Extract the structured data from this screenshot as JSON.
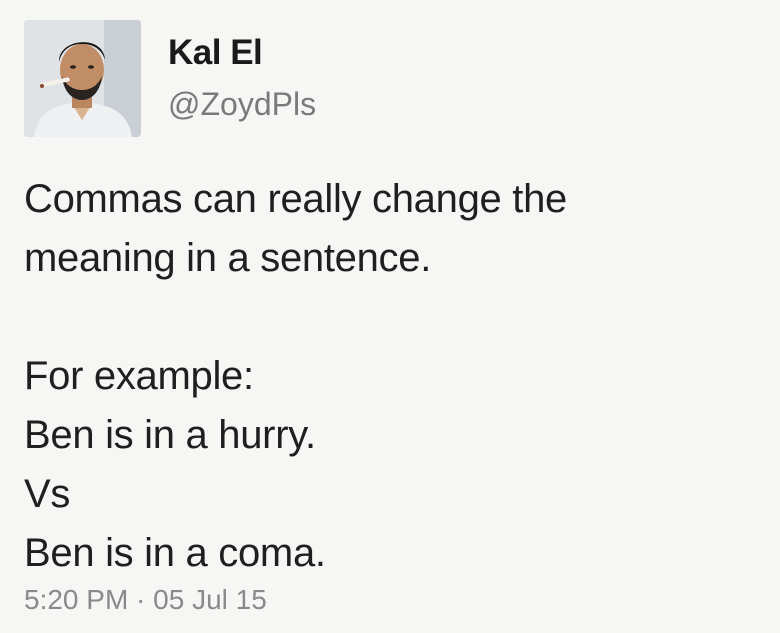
{
  "user": {
    "display_name": "Kal El",
    "handle": "@ZoydPls"
  },
  "tweet": {
    "lines": [
      "Commas can really change the",
      "meaning in a sentence.",
      "",
      "For example:",
      "Ben is in a hurry.",
      "Vs",
      "Ben is in a coma."
    ],
    "timestamp": "5:20 PM · 05 Jul 15"
  },
  "colors": {
    "background": "#f6f6f4",
    "text": "#1f1f1f",
    "muted": "#7a7a7a"
  }
}
